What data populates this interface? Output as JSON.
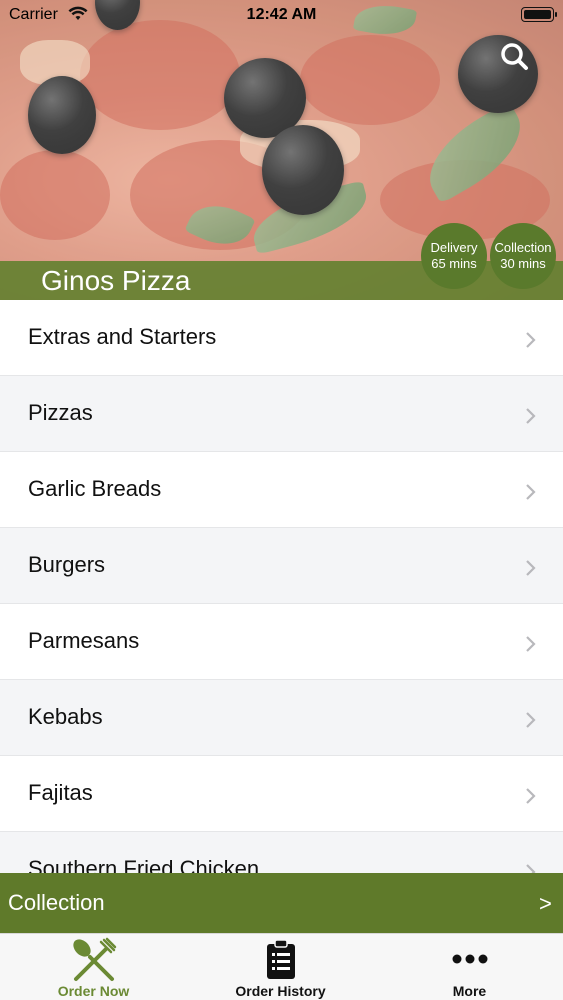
{
  "status_bar": {
    "carrier": "Carrier",
    "time": "12:42 AM"
  },
  "restaurant": {
    "name": "Ginos Pizza",
    "delivery": {
      "label": "Delivery",
      "time": "65 mins"
    },
    "collection": {
      "label": "Collection",
      "time": "30 mins"
    }
  },
  "menu": {
    "items": [
      {
        "label": "Extras and Starters"
      },
      {
        "label": "Pizzas"
      },
      {
        "label": "Garlic Breads"
      },
      {
        "label": "Burgers"
      },
      {
        "label": "Parmesans"
      },
      {
        "label": "Kebabs"
      },
      {
        "label": "Fajitas"
      },
      {
        "label": "Southern Fried Chicken"
      }
    ]
  },
  "order_mode": {
    "label": "Collection",
    "arrow": ">"
  },
  "tabs": [
    {
      "label": "Order Now",
      "icon": "fork-knife-icon",
      "active": true
    },
    {
      "label": "Order History",
      "icon": "clipboard-list-icon",
      "active": false
    },
    {
      "label": "More",
      "icon": "more-dots-icon",
      "active": false
    }
  ],
  "colors": {
    "brand_green": "#5f7a2a",
    "active_tab": "#6b8a34"
  }
}
